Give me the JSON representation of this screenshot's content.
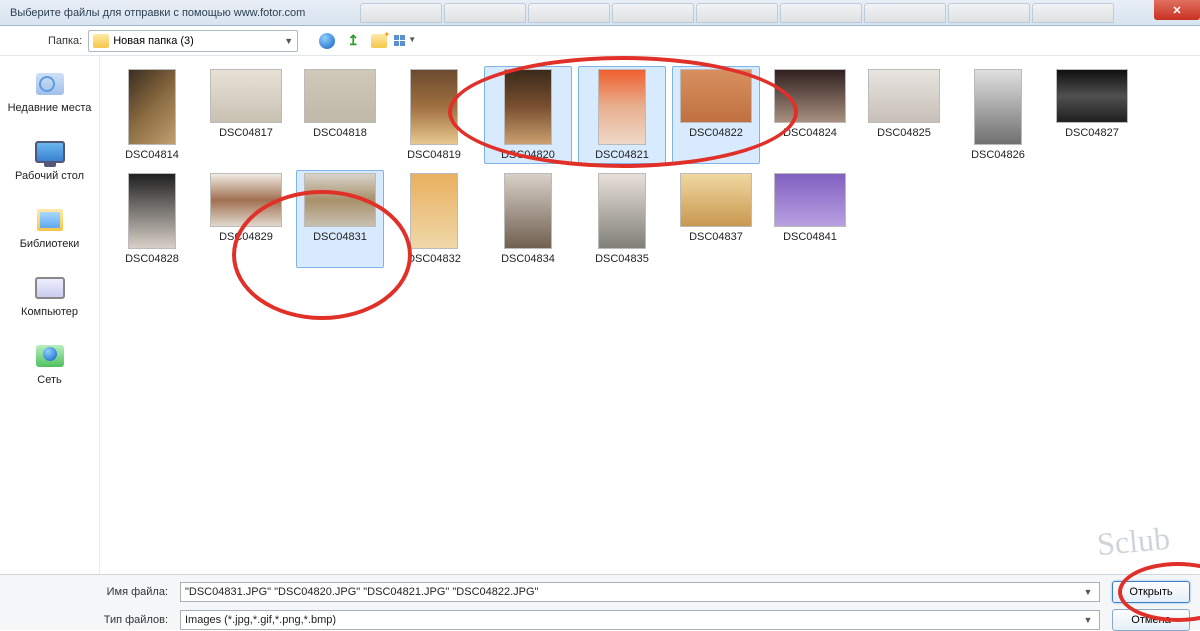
{
  "window": {
    "title": "Выберите файлы для отправки с помощью www.fotor.com",
    "close_glyph": "✕"
  },
  "toolbar": {
    "folder_label": "Папка:",
    "folder_value": "Новая папка (3)"
  },
  "sidebar": [
    {
      "name": "places-recent",
      "label": "Недавние места"
    },
    {
      "name": "places-desktop",
      "label": "Рабочий стол"
    },
    {
      "name": "places-libraries",
      "label": "Библиотеки"
    },
    {
      "name": "places-computer",
      "label": "Компьютер"
    },
    {
      "name": "places-network",
      "label": "Сеть"
    }
  ],
  "files": [
    {
      "label": "DSC04814",
      "selected": false,
      "shape": "tall",
      "bg": "linear-gradient(135deg,#3a2e20,#8a6a40,#c0a070)"
    },
    {
      "label": "DSC04817",
      "selected": false,
      "shape": "wide",
      "bg": "linear-gradient(#e8e2d6,#d8d2c6,#c8c0b0)"
    },
    {
      "label": "DSC04818",
      "selected": false,
      "shape": "wide",
      "bg": "linear-gradient(#d0c8b8,#c0b8a8)"
    },
    {
      "label": "DSC04819",
      "selected": false,
      "shape": "tall",
      "bg": "linear-gradient(#6a4a30,#a07040,#e8c890)"
    },
    {
      "label": "DSC04820",
      "selected": true,
      "shape": "tall",
      "bg": "linear-gradient(#3a2a1a,#7a5030,#caa070)"
    },
    {
      "label": "DSC04821",
      "selected": true,
      "shape": "tall",
      "bg": "linear-gradient(#f06030,#e8b090,#f0d8c8)"
    },
    {
      "label": "DSC04822",
      "selected": true,
      "shape": "wide",
      "bg": "linear-gradient(#d89060,#c07040)"
    },
    {
      "label": "DSC04824",
      "selected": false,
      "shape": "wide",
      "bg": "linear-gradient(#302020,#a89080)"
    },
    {
      "label": "DSC04825",
      "selected": false,
      "shape": "wide",
      "bg": "linear-gradient(#e8e4e0,#c8c0b8)"
    },
    {
      "label": "DSC04826",
      "selected": false,
      "shape": "tall",
      "bg": "linear-gradient(#e0e0e0,#707070)"
    },
    {
      "label": "DSC04827",
      "selected": false,
      "shape": "wide",
      "bg": "linear-gradient(#101010,#505050,#202020)"
    },
    {
      "label": "DSC04828",
      "selected": false,
      "shape": "tall",
      "bg": "linear-gradient(#202020,#d8d0c8)"
    },
    {
      "label": "DSC04829",
      "selected": false,
      "shape": "wide",
      "bg": "linear-gradient(#f0ece4,#a07050,#e0d8cc)"
    },
    {
      "label": "DSC04831",
      "selected": true,
      "shape": "wide",
      "bg": "linear-gradient(#d8d4cc,#a8906a,#c8c0b0)"
    },
    {
      "label": "DSC04832",
      "selected": false,
      "shape": "tall",
      "bg": "linear-gradient(#e8b060,#f0d8a8)"
    },
    {
      "label": "DSC04834",
      "selected": false,
      "shape": "tall",
      "bg": "linear-gradient(#d8d0c8,#706050)"
    },
    {
      "label": "DSC04835",
      "selected": false,
      "shape": "tall",
      "bg": "linear-gradient(#e8e0d8,#808078)"
    },
    {
      "label": "DSC04837",
      "selected": false,
      "shape": "wide",
      "bg": "linear-gradient(#f0d8a0,#c89850)"
    },
    {
      "label": "DSC04841",
      "selected": false,
      "shape": "wide",
      "bg": "linear-gradient(#8060c0,#b8a0e0)"
    }
  ],
  "bottom": {
    "filename_label": "Имя файла:",
    "filename_value": "\"DSC04831.JPG\" \"DSC04820.JPG\" \"DSC04821.JPG\" \"DSC04822.JPG\"",
    "filetype_label": "Тип файлов:",
    "filetype_value": "Images (*.jpg,*.gif,*.png,*.bmp)",
    "open_label": "Открыть",
    "cancel_label": "Отмена"
  },
  "watermark": "Sclub"
}
